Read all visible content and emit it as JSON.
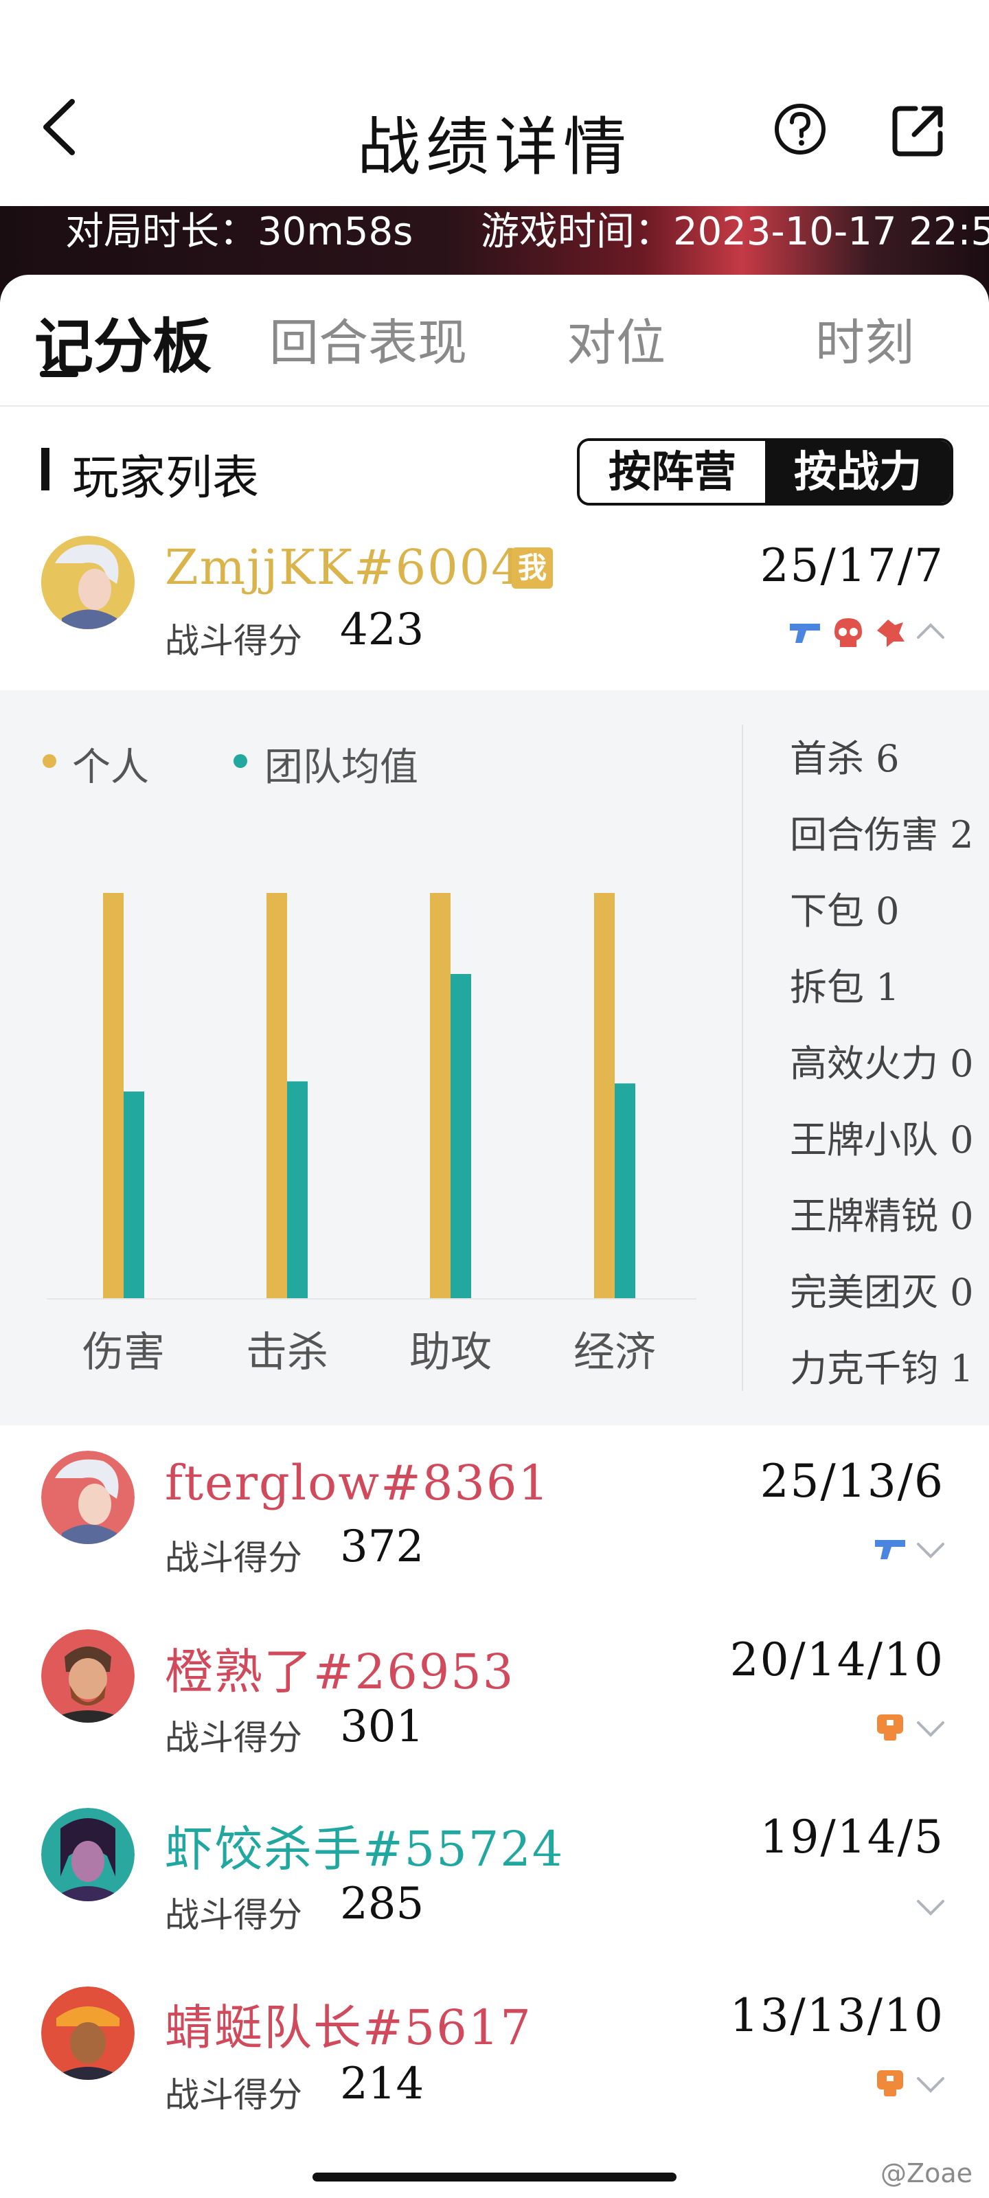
{
  "header": {
    "title": "战绩详情"
  },
  "banner": {
    "duration": "对局时长：30m58s",
    "game_time": "游戏时间：2023-10-17 22:5"
  },
  "tabs": [
    {
      "label": "记分板",
      "active": true
    },
    {
      "label": "回合表现",
      "active": false
    },
    {
      "label": "对位",
      "active": false
    },
    {
      "label": "时刻",
      "active": false
    }
  ],
  "player_list": {
    "title": "玩家列表",
    "sort_options": [
      {
        "label": "按阵营",
        "selected": false
      },
      {
        "label": "按战力",
        "selected": true
      }
    ]
  },
  "score_label": "战斗得分",
  "players": [
    {
      "name": "ZmjjKK#60041",
      "name_color": "#dab34b",
      "me_badge": "我",
      "score": "423",
      "kda": "25/17/7",
      "expanded": true,
      "icons": [
        "gun-icon",
        "skull-icon",
        "clutch-icon",
        "chevron-up-icon"
      ]
    },
    {
      "name": "fterglow#8361",
      "name_color": "#d04a5c",
      "score": "372",
      "kda": "25/13/6",
      "expanded": false,
      "icons": [
        "gun-icon",
        "chevron-down-icon"
      ]
    },
    {
      "name": "橙熟了#26953",
      "name_color": "#d04a5c",
      "score": "301",
      "kda": "20/14/10",
      "expanded": false,
      "icons": [
        "spike-icon",
        "chevron-down-icon"
      ]
    },
    {
      "name": "虾饺杀手#55724",
      "name_color": "#1fa7a0",
      "score": "285",
      "kda": "19/14/5",
      "expanded": false,
      "icons": [
        "chevron-down-icon"
      ]
    },
    {
      "name": "蜻蜓队长#5617",
      "name_color": "#d04a5c",
      "score": "214",
      "kda": "13/13/10",
      "expanded": false,
      "icons": [
        "spike-icon",
        "chevron-down-icon"
      ]
    }
  ],
  "detail": {
    "legend": [
      {
        "label": "个人",
        "color": "#e3b74e"
      },
      {
        "label": "团队均值",
        "color": "#22a89e"
      }
    ],
    "stats": [
      "首杀 6",
      "回合伤害 2",
      "下包 0",
      "拆包 1",
      "高效火力 0",
      "王牌小队 0",
      "王牌精锐 0",
      "完美团灭 0",
      "力克千钧 1"
    ]
  },
  "chart_data": {
    "type": "bar",
    "categories": [
      "伤害",
      "击杀",
      "助攻",
      "经济"
    ],
    "series": [
      {
        "name": "个人",
        "values": [
          1.0,
          1.0,
          1.0,
          1.0
        ]
      },
      {
        "name": "团队均值",
        "values": [
          0.51,
          0.535,
          0.8,
          0.53
        ]
      }
    ],
    "ylim": [
      0,
      1.0
    ]
  },
  "watermark": "@Zoae"
}
